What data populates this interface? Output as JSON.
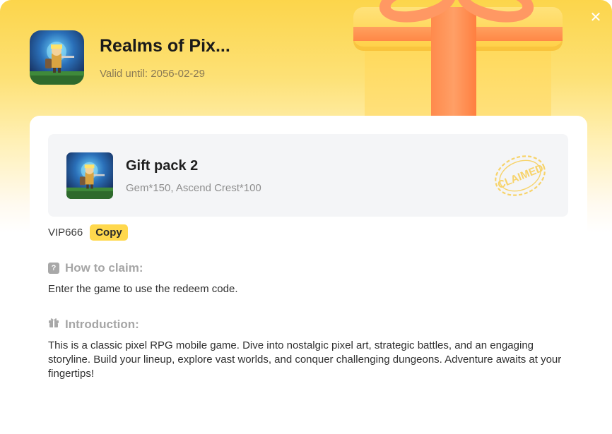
{
  "header": {
    "game_title": "Realms of Pix...",
    "valid_until": "Valid until: 2056-02-29",
    "close_icon": "close-icon"
  },
  "pack": {
    "title": "Gift pack 2",
    "items": "Gem*150, Ascend Crest*100",
    "status_stamp": "CLAIMED"
  },
  "code": {
    "value": "VIP666",
    "copy_label": "Copy"
  },
  "how_to_claim": {
    "icon": "question-icon",
    "heading": "How to claim:",
    "text": "Enter the game to use the redeem code."
  },
  "introduction": {
    "icon": "gift-icon",
    "heading": "Introduction:",
    "text": "This is a classic pixel RPG mobile game. Dive into nostalgic pixel art, strategic battles, and an engaging storyline. Build your lineup, explore vast worlds, and conquer challenging dungeons. Adventure awaits at your fingertips!"
  },
  "colors": {
    "accent": "#ffd84d",
    "header_gradient_top": "#fcd54b",
    "ribbon": "#ff8a4c",
    "stamp": "#f7d36a"
  }
}
